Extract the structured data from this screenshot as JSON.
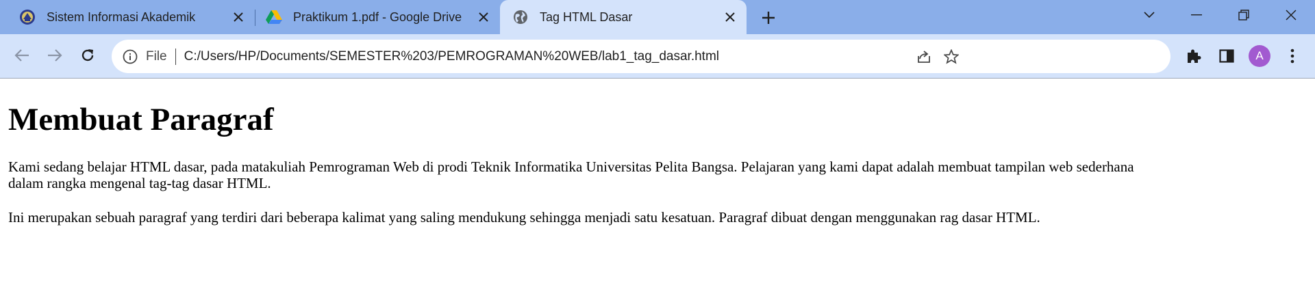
{
  "tabs": [
    {
      "title": "Sistem Informasi Akademik",
      "icon": "university-logo-icon"
    },
    {
      "title": "Praktikum 1.pdf - Google Drive",
      "icon": "google-drive-icon"
    },
    {
      "title": "Tag HTML Dasar",
      "icon": "globe-icon"
    }
  ],
  "omnibox": {
    "scheme_label": "File",
    "url": "C:/Users/HP/Documents/SEMESTER%203/PEMROGRAMAN%20WEB/lab1_tag_dasar.html"
  },
  "profile": {
    "initial": "A",
    "color": "#a25ad0"
  },
  "page": {
    "heading": "Membuat Paragraf",
    "paragraph_1_line_1": "Kami sedang belajar HTML dasar, pada matakuliah Pemrograman Web di prodi Teknik Informatika Universitas Pelita Bangsa. Pelajaran yang kami dapat adalah membuat tampilan web sederhana",
    "paragraph_1_line_2": "dalam rangka mengenal tag-tag dasar HTML.",
    "paragraph_2": "Ini merupakan sebuah paragraf yang terdiri dari beberapa kalimat yang saling mendukung sehingga menjadi satu kesatuan. Paragraf dibuat dengan menggunakan rag dasar HTML."
  },
  "colors": {
    "tabstrip_bg": "#8aaee9",
    "toolbar_bg": "#d4e3fb",
    "omnibox_bg": "#ffffff"
  }
}
